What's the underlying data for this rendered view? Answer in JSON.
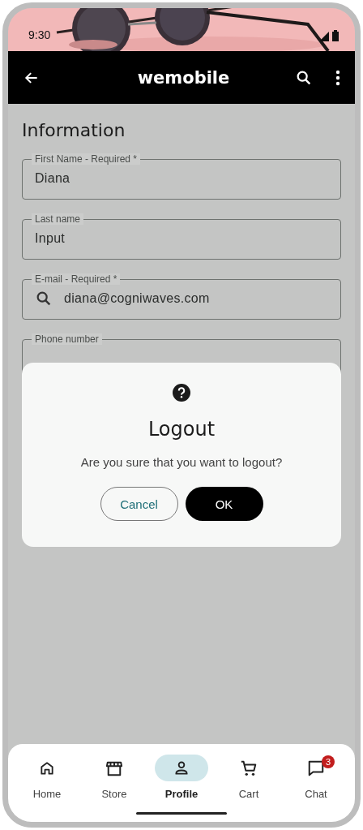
{
  "status_bar": {
    "time": "9:30"
  },
  "app_bar": {
    "title": "wemobile"
  },
  "section_title": "Information",
  "fields": [
    {
      "label": "First Name - Required *",
      "value": "Diana",
      "kind": "text"
    },
    {
      "label": "Last name",
      "value": "Input",
      "kind": "text"
    },
    {
      "label": "E-mail - Required *",
      "value": "diana@cogniwaves.com",
      "kind": "search"
    },
    {
      "label": "Phone number",
      "kind": "text"
    }
  ],
  "dialog": {
    "title": "Logout",
    "message": "Are you sure that you want to logout?",
    "buttons": [
      {
        "label": "Cancel",
        "kind": "outlined"
      },
      {
        "label": "OK",
        "kind": "filled"
      }
    ]
  },
  "nav": [
    {
      "label": "Home",
      "selected": false
    },
    {
      "label": "Store",
      "selected": false
    },
    {
      "label": "Profile",
      "selected": true
    },
    {
      "label": "Cart",
      "selected": false
    },
    {
      "label": "Chat",
      "selected": false,
      "badge": "3"
    }
  ]
}
